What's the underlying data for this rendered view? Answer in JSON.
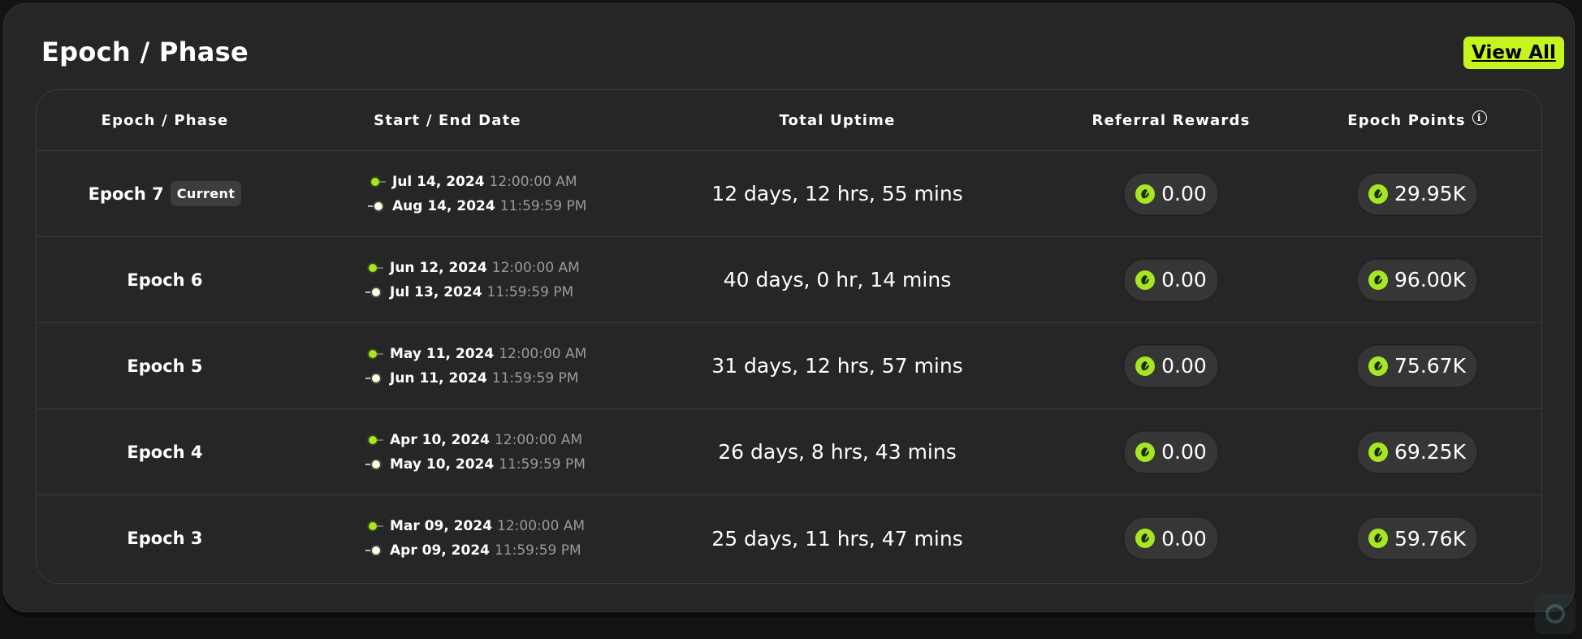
{
  "card": {
    "title": "Epoch / Phase",
    "view_all_label": "View All"
  },
  "table": {
    "headers": {
      "epoch": "Epoch / Phase",
      "dates": "Start / End Date",
      "uptime": "Total Uptime",
      "referral": "Referral Rewards",
      "points": "Epoch Points"
    },
    "rows": [
      {
        "epoch": "Epoch 7",
        "badge": "Current",
        "start_date": "Jul 14, 2024",
        "start_time": "12:00:00 AM",
        "end_date": "Aug 14, 2024",
        "end_time": "11:59:59 PM",
        "uptime": "12 days, 12 hrs, 55 mins",
        "referral": "0.00",
        "points": "29.95K"
      },
      {
        "epoch": "Epoch 6",
        "badge": "",
        "start_date": "Jun 12, 2024",
        "start_time": "12:00:00 AM",
        "end_date": "Jul 13, 2024",
        "end_time": "11:59:59 PM",
        "uptime": "40 days, 0 hr, 14 mins",
        "referral": "0.00",
        "points": "96.00K"
      },
      {
        "epoch": "Epoch 5",
        "badge": "",
        "start_date": "May 11, 2024",
        "start_time": "12:00:00 AM",
        "end_date": "Jun 11, 2024",
        "end_time": "11:59:59 PM",
        "uptime": "31 days, 12 hrs, 57 mins",
        "referral": "0.00",
        "points": "75.67K"
      },
      {
        "epoch": "Epoch 4",
        "badge": "",
        "start_date": "Apr 10, 2024",
        "start_time": "12:00:00 AM",
        "end_date": "May 10, 2024",
        "end_time": "11:59:59 PM",
        "uptime": "26 days, 8 hrs, 43 mins",
        "referral": "0.00",
        "points": "69.25K"
      },
      {
        "epoch": "Epoch 3",
        "badge": "",
        "start_date": "Mar 09, 2024",
        "start_time": "12:00:00 AM",
        "end_date": "Apr 09, 2024",
        "end_time": "11:59:59 PM",
        "uptime": "25 days, 11 hrs, 47 mins",
        "referral": "0.00",
        "points": "59.76K"
      }
    ]
  },
  "icons": {
    "points_info": "info-icon",
    "token": "leaf-token-icon",
    "start_marker": "start-dot-icon",
    "end_marker": "end-dot-icon"
  },
  "colors": {
    "accent": "#c6f41e",
    "card_bg": "#262626",
    "page_bg": "#131313",
    "muted_text": "#9a9a9a"
  }
}
